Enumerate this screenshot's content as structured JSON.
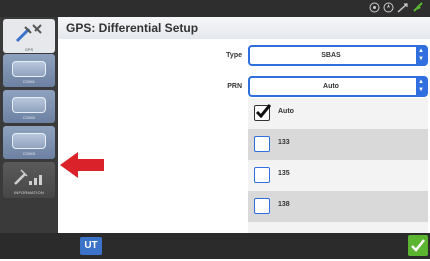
{
  "header": {
    "title": "GPS: Differential Setup"
  },
  "sidebar": {
    "top_caption": "GPS",
    "items": [
      {
        "caption": "COM1"
      },
      {
        "caption": "COM2"
      },
      {
        "caption": "COM3"
      },
      {
        "caption": "INFORMATION"
      }
    ]
  },
  "fields": {
    "type": {
      "label": "Type",
      "value": "SBAS"
    },
    "prn": {
      "label": "PRN",
      "value": "Auto"
    }
  },
  "dropdown": {
    "options": [
      {
        "label": "Auto",
        "checked": true
      },
      {
        "label": "133",
        "checked": false
      },
      {
        "label": "135",
        "checked": false
      },
      {
        "label": "138",
        "checked": false
      }
    ]
  },
  "footer": {
    "ut_label": "UT"
  },
  "colors": {
    "accent": "#2f6fe0",
    "ok": "#5cb531",
    "arrow": "#d9222a"
  }
}
